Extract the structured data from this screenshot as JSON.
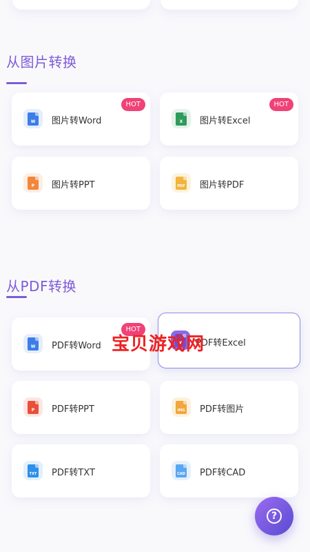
{
  "sections": [
    {
      "title": "从图片转换",
      "cards": [
        {
          "label": "图片转Word",
          "hot": true,
          "icon": "word-doc-icon",
          "color": "#3d7de6"
        },
        {
          "label": "图片转Excel",
          "hot": true,
          "icon": "excel-doc-icon",
          "color": "#2e9a5b"
        },
        {
          "label": "图片转PPT",
          "hot": false,
          "icon": "ppt-doc-icon",
          "color": "#f2863c"
        },
        {
          "label": "图片转PDF",
          "hot": false,
          "icon": "pdf-image-icon",
          "color": "#f2b43c"
        }
      ]
    },
    {
      "title": "从PDF转换",
      "cards": [
        {
          "label": "PDF转Word",
          "hot": true,
          "icon": "word-doc-icon",
          "color": "#3d7de6"
        },
        {
          "label": "PDF转Excel",
          "hot": false,
          "icon": "excel-doc-icon",
          "color": "#7a5ae0"
        },
        {
          "label": "PDF转PPT",
          "hot": false,
          "icon": "ppt-doc-icon",
          "color": "#e8503a"
        },
        {
          "label": "PDF转图片",
          "hot": false,
          "icon": "image-doc-icon",
          "color": "#f2a63c"
        },
        {
          "label": "PDF转TXT",
          "hot": false,
          "icon": "txt-doc-icon",
          "color": "#2f8fe8"
        },
        {
          "label": "PDF转CAD",
          "hot": false,
          "icon": "cad-doc-icon",
          "color": "#5aa7f0"
        }
      ]
    }
  ],
  "hot_badge": "HOT",
  "icon_glyphs": {
    "word": "W",
    "excel": "X",
    "ppt": "P",
    "pdf": "PDF",
    "image": "IMG",
    "txt": "TXT",
    "cad": "CAD"
  },
  "watermark": "宝贝游戏网",
  "help_button": {
    "glyph": "?",
    "icon": "help-question-icon"
  },
  "colors": {
    "accent": "#7e5bd8",
    "hot": "#f04277",
    "selected_border": "#8f8be8"
  }
}
